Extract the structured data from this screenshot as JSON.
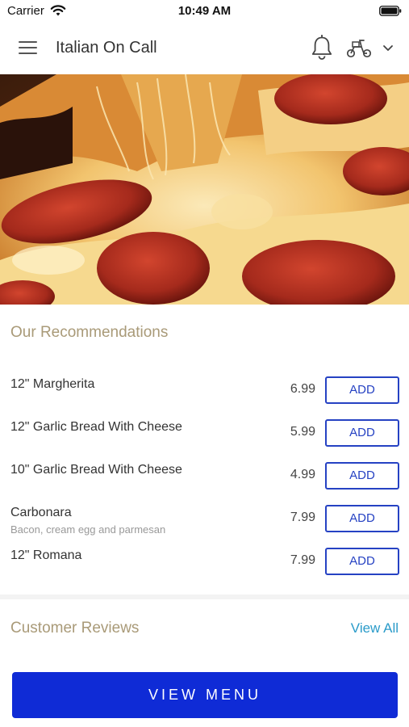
{
  "status_bar": {
    "carrier": "Carrier",
    "time": "10:49 AM",
    "icons": [
      "wifi-icon",
      "battery-icon"
    ]
  },
  "header": {
    "title": "Italian On Call",
    "icons": [
      "menu-icon",
      "bell-icon",
      "scooter-icon",
      "chevron-down-icon"
    ]
  },
  "hero": {
    "image": "pepperoni pizza with stretched cheese"
  },
  "recommendations": {
    "title": "Our Recommendations",
    "items": [
      {
        "name": "12\" Margherita",
        "description": "",
        "price": "6.99",
        "button": "ADD"
      },
      {
        "name": "12\" Garlic Bread With Cheese",
        "description": "",
        "price": "5.99",
        "button": "ADD"
      },
      {
        "name": "10\" Garlic Bread With Cheese",
        "description": "",
        "price": "4.99",
        "button": "ADD"
      },
      {
        "name": "Carbonara",
        "description": "Bacon, cream egg and parmesan",
        "price": "7.99",
        "button": "ADD"
      },
      {
        "name": "12\" Romana",
        "description": "",
        "price": "7.99",
        "button": "ADD"
      }
    ]
  },
  "reviews": {
    "title": "Customer Reviews",
    "view_all": "View All"
  },
  "footer": {
    "view_menu": "VIEW MENU"
  },
  "colors": {
    "accent_blue": "#0f2bd6",
    "add_button_border": "#2642c3",
    "section_title": "#a99a78",
    "link": "#2a9bc9"
  }
}
